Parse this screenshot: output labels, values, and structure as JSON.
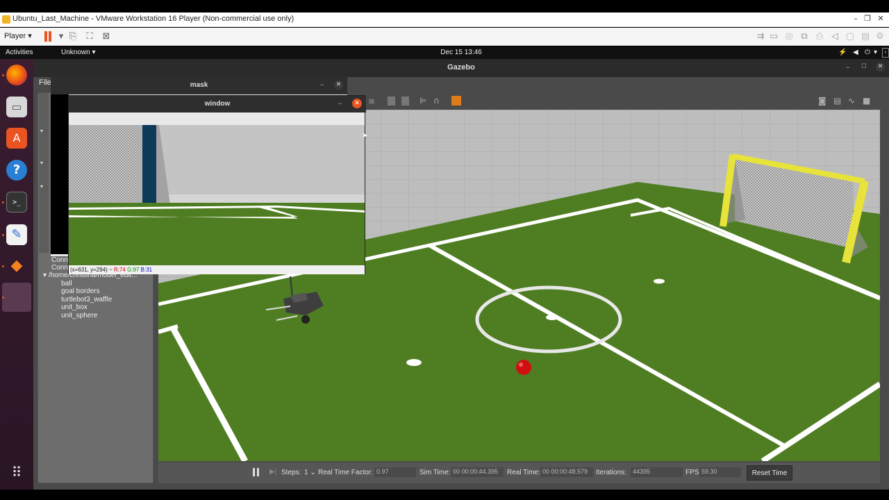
{
  "vmware": {
    "title": "Ubuntu_Last_Machine - VMware Workstation 16 Player (Non-commercial use only)",
    "player_menu": "Player",
    "minimize": "–",
    "maximize": "❐",
    "close": "✕"
  },
  "ubuntu_panel": {
    "activities": "Activities",
    "app_menu": "Unknown",
    "datetime": "Dec 15  13:46"
  },
  "gazebo": {
    "title": "Gazebo",
    "file_menu": "File",
    "tree_items": [
      "Conn",
      "Conn",
      "/home/christina/model_edit...",
      "ball",
      "goal borders",
      "turtlebot3_waffle",
      "unit_box",
      "unit_sphere"
    ],
    "bottom": {
      "steps_label": "Steps:",
      "steps_value": "1",
      "rtf_label": "Real Time Factor:",
      "rtf_value": "0.97",
      "sim_time_label": "Sim Time:",
      "sim_time_value": "00 00:00:44.395",
      "real_time_label": "Real Time:",
      "real_time_value": "00 00:00:48.579",
      "iterations_label": "Iterations:",
      "iterations_value": "44395",
      "fps_label": "FPS:",
      "fps_value": "59.30",
      "reset_label": "Reset Time"
    }
  },
  "mask_window": {
    "title": "mask"
  },
  "camera_window": {
    "title": "window",
    "status_coords": "(x=631, y=294) ~",
    "status_r": "R:74",
    "status_g": "G:97",
    "status_b": "B:31"
  },
  "colors": {
    "field_green": "#4c7a23",
    "ubuntu_orange": "#e95420",
    "goal_yellow": "#e8e33a",
    "ball_red": "#d01010"
  }
}
